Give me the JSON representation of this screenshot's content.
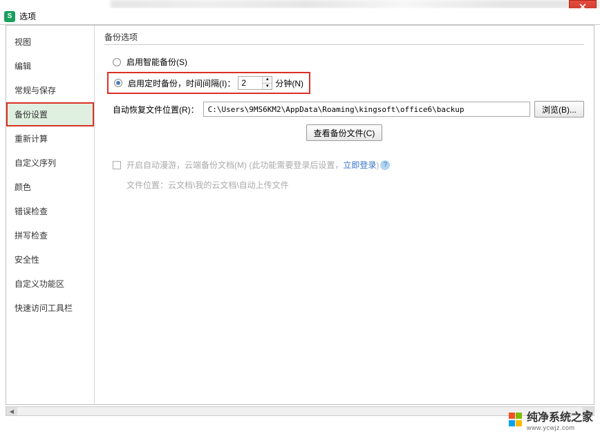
{
  "window": {
    "title": "选项"
  },
  "sidebar": {
    "items": [
      {
        "label": "视图"
      },
      {
        "label": "编辑"
      },
      {
        "label": "常规与保存"
      },
      {
        "label": "备份设置"
      },
      {
        "label": "重新计算"
      },
      {
        "label": "自定义序列"
      },
      {
        "label": "颜色"
      },
      {
        "label": "错误检查"
      },
      {
        "label": "拼写检查"
      },
      {
        "label": "安全性"
      },
      {
        "label": "自定义功能区"
      },
      {
        "label": "快速访问工具栏"
      }
    ]
  },
  "content": {
    "section_title": "备份选项",
    "smart_backup_label": "启用智能备份(S)",
    "timed_backup_prefix": "启用定时备份，时间间隔(I)：",
    "timed_backup_value": "2",
    "timed_backup_unit": "分钟(N)",
    "recovery_path_label": "自动恢复文件位置(R)：",
    "recovery_path_value": "C:\\Users\\9MS6KM2\\AppData\\Roaming\\kingsoft\\office6\\backup",
    "browse_btn": "浏览(B)...",
    "view_backup_btn": "查看备份文件(C)",
    "cloud_roaming_label": "开启自动漫游，云端备份文档(M) (此功能需要登录后设置，",
    "login_link": "立即登录",
    "cloud_roaming_suffix": ")",
    "cloud_location_label": "文件位置：云文档\\我的云文档\\自动上传文件"
  },
  "watermark": {
    "text": "纯净系统之家",
    "url": "www.ycwjz.com"
  }
}
